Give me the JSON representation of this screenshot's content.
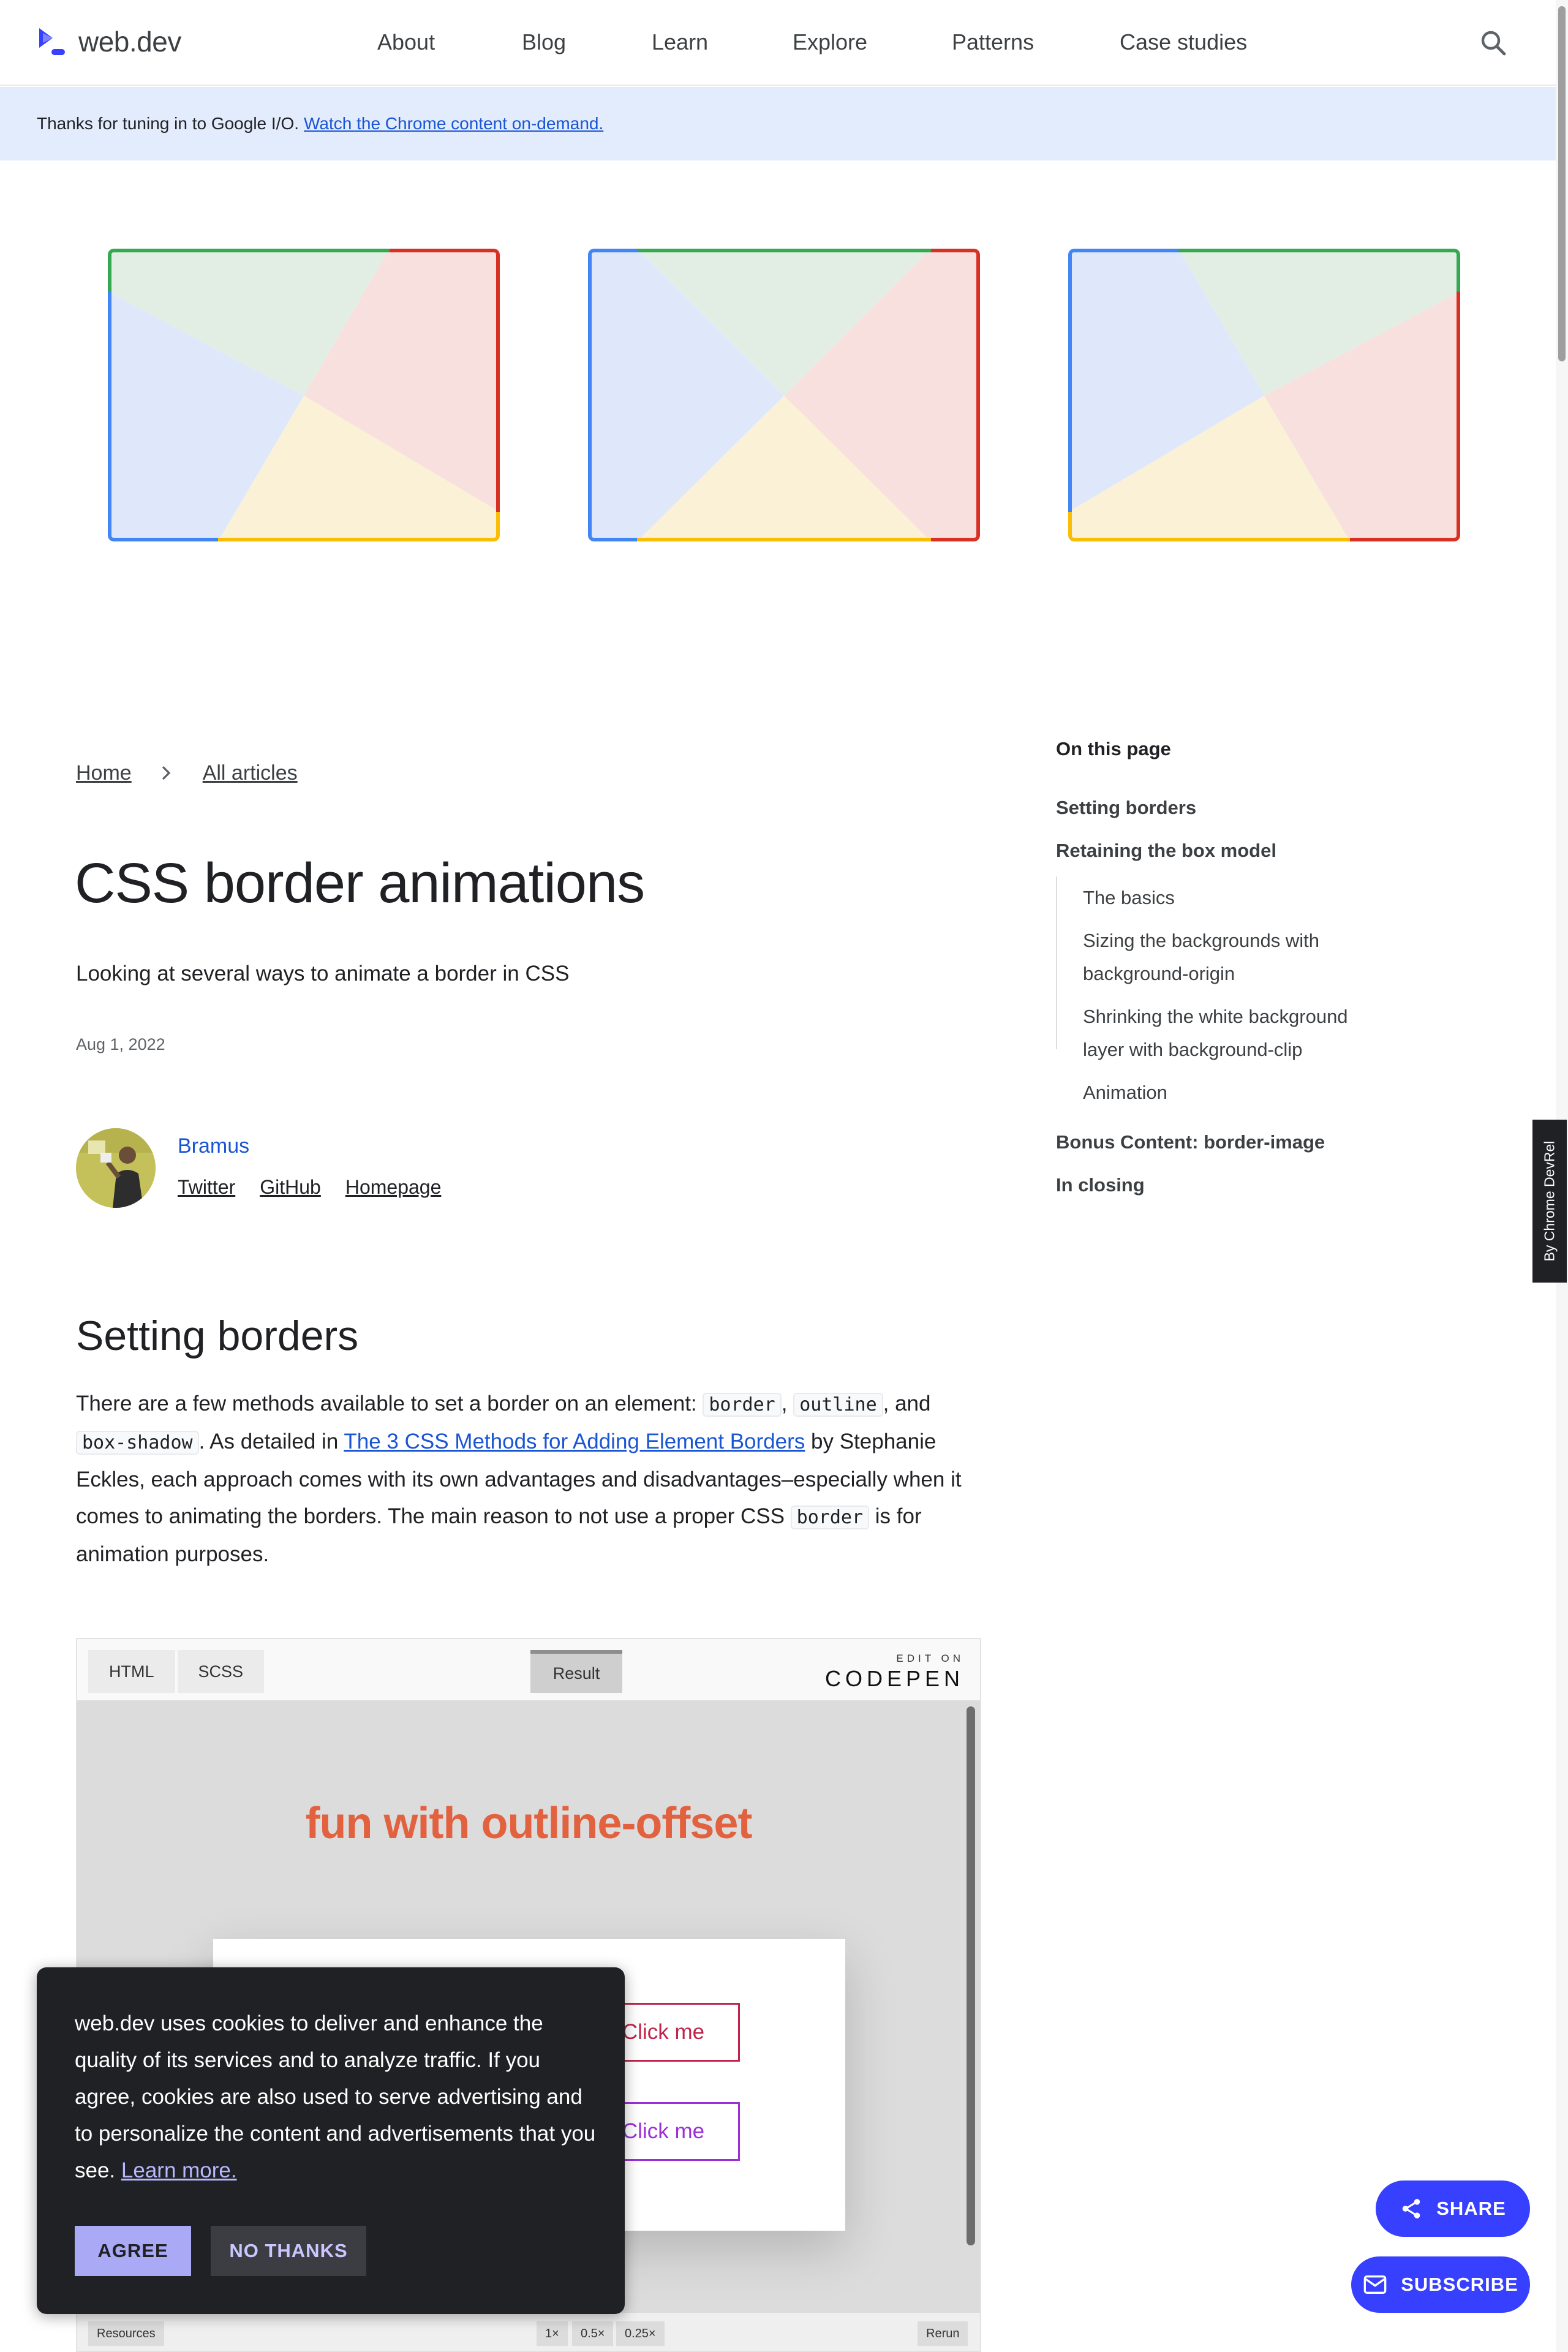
{
  "header": {
    "logo_text": "web.dev",
    "nav": [
      "About",
      "Blog",
      "Learn",
      "Explore",
      "Patterns",
      "Case studies"
    ]
  },
  "banner": {
    "text": "Thanks for tuning in to Google I/O.",
    "link": "Watch the Chrome content on-demand."
  },
  "hero": {
    "colors": {
      "green": "#34a853",
      "red": "#d93025",
      "yellow": "#fbbc04",
      "blue": "#4285f4"
    }
  },
  "breadcrumb": {
    "home": "Home",
    "all": "All articles"
  },
  "article": {
    "title": "CSS border animations",
    "subtitle": "Looking at several ways to animate a border in CSS",
    "date": "Aug 1, 2022"
  },
  "author": {
    "name": "Bramus",
    "links": [
      "Twitter",
      "GitHub",
      "Homepage"
    ]
  },
  "toc": {
    "title": "On this page",
    "items": [
      "Setting borders",
      "Retaining the box model",
      "The basics",
      "Sizing the backgrounds with",
      "background-origin",
      "Shrinking the white background",
      "layer with background-clip",
      "Animation",
      "Bonus Content: border-image",
      "In closing"
    ]
  },
  "devrel": {
    "label": "By  Chrome DevRel"
  },
  "section": {
    "heading": "Setting borders",
    "p_intro": "There are a few methods available to set a border on an element: ",
    "code_border": "border",
    "code_outline": "outline",
    "p_and": ", and",
    "code_box_shadow": "box-shadow",
    "p_detailed": ". As detailed in ",
    "link": "The 3 CSS Methods for Adding Element Borders",
    "p_rest": " by Stephanie Eckles, each approach comes with its own advantages and disadvantages–especially when it comes to animating the borders. The main reason to not use a proper CSS ",
    "p_end": " is for animation purposes."
  },
  "codepen": {
    "tabs": [
      "HTML",
      "SCSS"
    ],
    "result_tab": "Result",
    "edit_small": "EDIT ON",
    "edit_big": "CODEPEN",
    "heading": "fun with outline-offset",
    "button_label": "Click me",
    "footer": {
      "resources": "Resources",
      "z1": "1×",
      "z05": "0.5×",
      "z025": "0.25×",
      "rerun": "Rerun"
    }
  },
  "cookie": {
    "text": "web.dev uses cookies to deliver and enhance the quality of its services and to analyze traffic. If you agree, cookies are also used to serve advertising and to personalize the content and advertisements that you see. ",
    "learn_more": "Learn more.",
    "agree": "AGREE",
    "no_thanks": "NO THANKS"
  },
  "fab": {
    "share": "SHARE",
    "subscribe": "SUBSCRIBE"
  }
}
